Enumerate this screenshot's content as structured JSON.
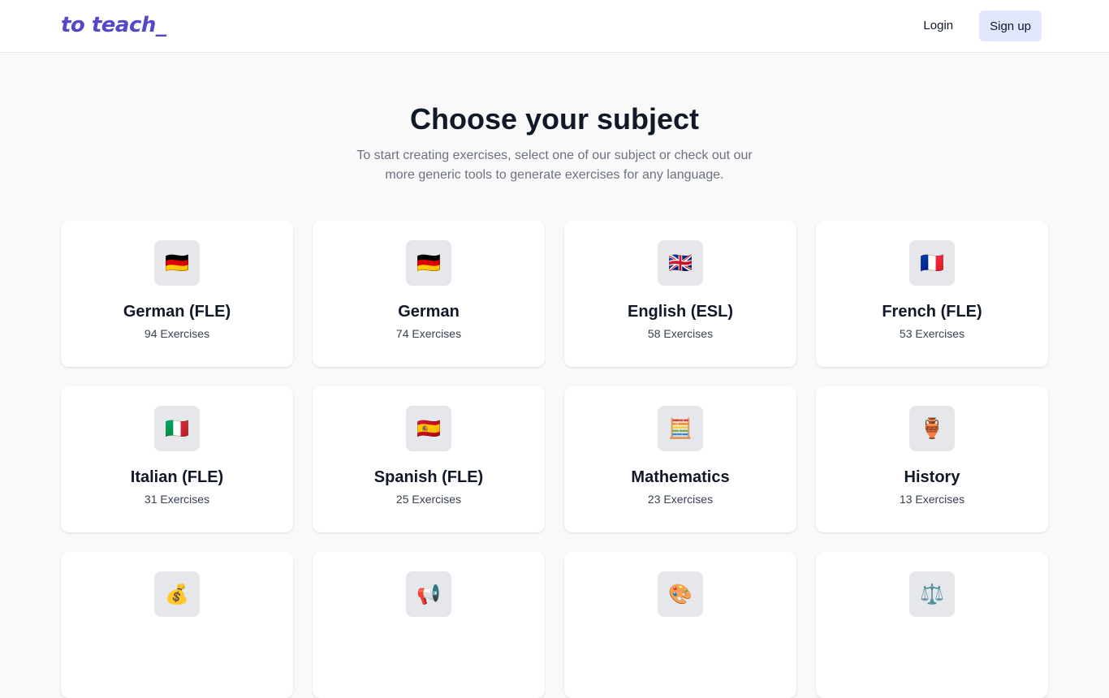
{
  "header": {
    "logo": "to teach_",
    "login_label": "Login",
    "signup_label": "Sign up"
  },
  "hero": {
    "title": "Choose your subject",
    "subtitle": "To start creating exercises, select one of our subject or check out our more generic tools to generate exercises for any language."
  },
  "subjects": [
    {
      "icon": "🇩🇪",
      "icon_name": "germany-flag-icon",
      "name": "German (FLE)",
      "count": "94 Exercises"
    },
    {
      "icon": "🇩🇪",
      "icon_name": "germany-flag-icon",
      "name": "German",
      "count": "74 Exercises"
    },
    {
      "icon": "🇬🇧",
      "icon_name": "uk-flag-icon",
      "name": "English (ESL)",
      "count": "58 Exercises"
    },
    {
      "icon": "🇫🇷",
      "icon_name": "france-flag-icon",
      "name": "French (FLE)",
      "count": "53 Exercises"
    },
    {
      "icon": "🇮🇹",
      "icon_name": "italy-flag-icon",
      "name": "Italian (FLE)",
      "count": "31 Exercises"
    },
    {
      "icon": "🇪🇸",
      "icon_name": "spain-flag-icon",
      "name": "Spanish (FLE)",
      "count": "25 Exercises"
    },
    {
      "icon": "🧮",
      "icon_name": "abacus-icon",
      "name": "Mathematics",
      "count": "23 Exercises"
    },
    {
      "icon": "🏺",
      "icon_name": "amphora-icon",
      "name": "History",
      "count": "13 Exercises"
    },
    {
      "icon": "💰",
      "icon_name": "money-bag-icon",
      "name": "",
      "count": ""
    },
    {
      "icon": "📢",
      "icon_name": "megaphone-icon",
      "name": "",
      "count": ""
    },
    {
      "icon": "🎨",
      "icon_name": "palette-icon",
      "name": "",
      "count": ""
    },
    {
      "icon": "⚖️",
      "icon_name": "scales-icon",
      "name": "",
      "count": ""
    }
  ],
  "colors": {
    "brand": "#5548c8",
    "signup_bg": "#e0e7ff",
    "page_bg": "#f9f9f9",
    "card_bg": "#ffffff",
    "icon_bg": "#e5e7eb"
  }
}
